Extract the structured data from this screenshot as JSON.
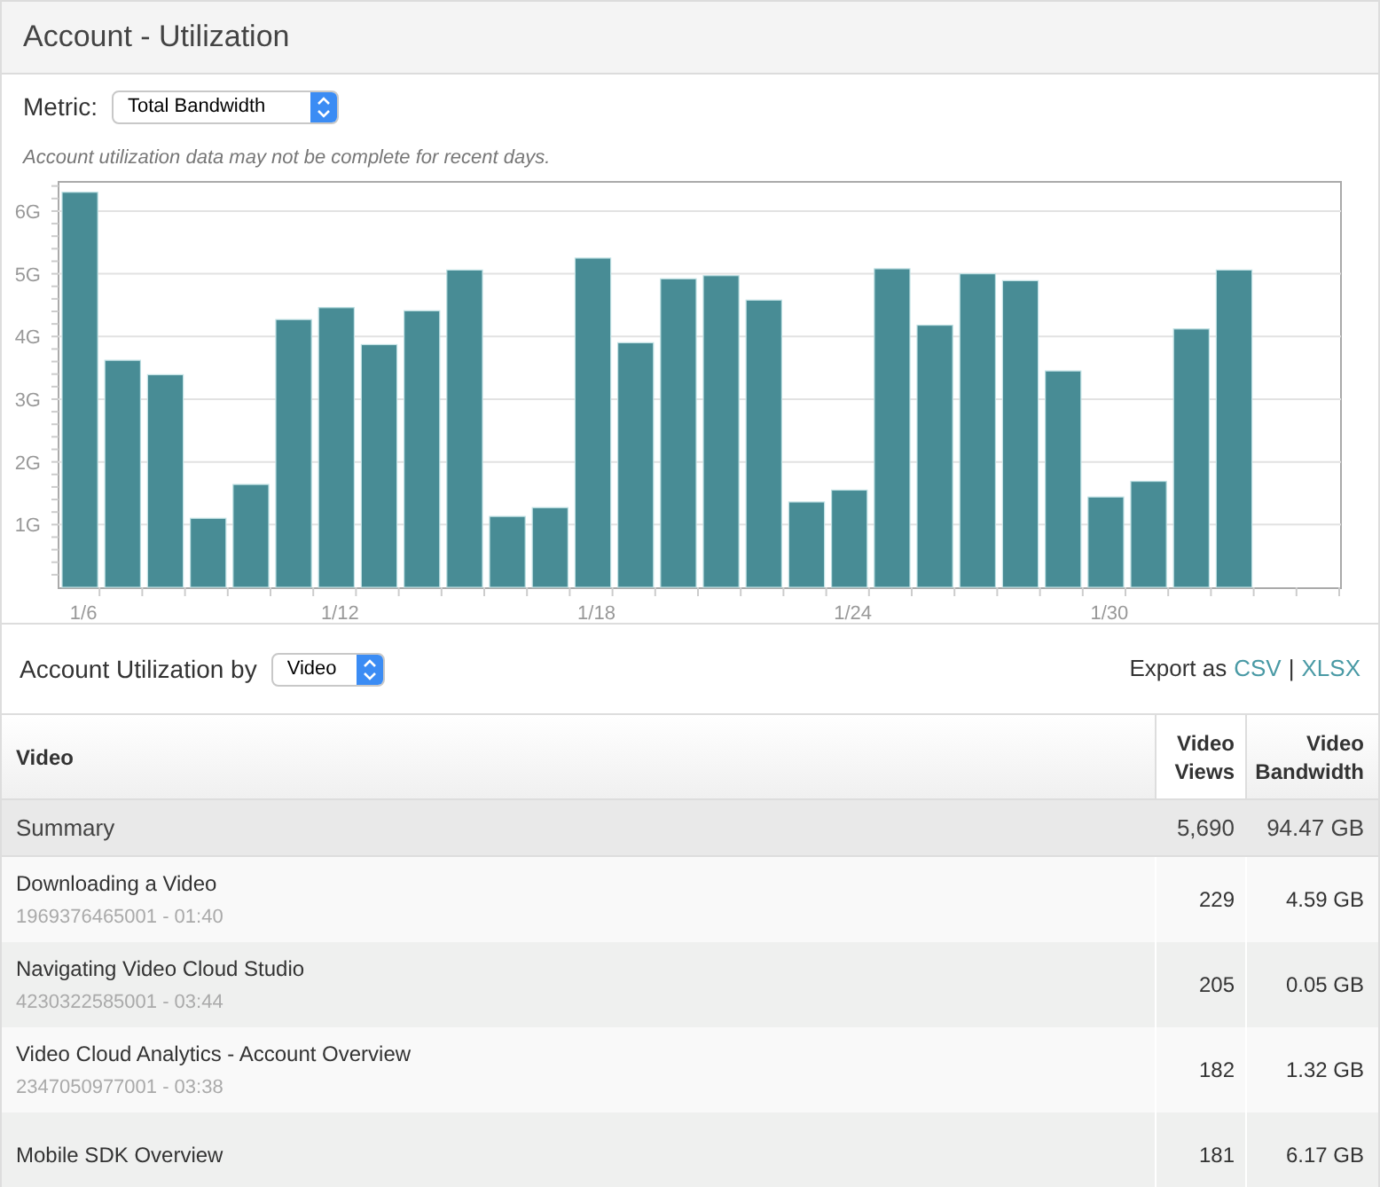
{
  "header": {
    "title": "Account - Utilization"
  },
  "metric": {
    "label": "Metric:",
    "value": "Total Bandwidth"
  },
  "note": "Account utilization data may not be complete for recent days.",
  "chart": {
    "chart_data": {
      "type": "bar",
      "ylim": [
        0,
        6.48
      ],
      "yticks": [
        {
          "value": 1,
          "label": "1G"
        },
        {
          "value": 2,
          "label": "2G"
        },
        {
          "value": 3,
          "label": "3G"
        },
        {
          "value": 4,
          "label": "4G"
        },
        {
          "value": 5,
          "label": "5G"
        },
        {
          "value": 6,
          "label": "6G"
        }
      ],
      "grid": true,
      "categories": [
        "1/6",
        null,
        null,
        null,
        null,
        null,
        "1/12",
        null,
        null,
        null,
        null,
        null,
        "1/18",
        null,
        null,
        null,
        null,
        null,
        "1/24",
        null,
        null,
        null,
        null,
        null,
        "1/30",
        null,
        null,
        null,
        null,
        null
      ],
      "series": [
        {
          "color": "#488c95",
          "values": [
            6.3,
            3.62,
            3.39,
            1.1,
            1.64,
            4.27,
            4.46,
            3.87,
            4.41,
            5.06,
            1.13,
            1.27,
            5.25,
            3.9,
            4.92,
            4.97,
            4.58,
            1.36,
            1.55,
            5.08,
            4.18,
            5.0,
            4.89,
            3.45,
            1.44,
            1.69,
            4.12,
            5.06,
            null,
            null
          ]
        }
      ]
    }
  },
  "breakdown": {
    "label": "Account Utilization by",
    "value": "Video",
    "export_label": "Export as",
    "links": [
      "CSV",
      "XLSX"
    ],
    "separator": "|"
  },
  "table": {
    "columns": [
      "Video",
      "Video Views",
      "Video Bandwidth"
    ],
    "summary": {
      "label": "Summary",
      "views": "5,690",
      "bandwidth": "94.47 GB"
    },
    "rows": [
      {
        "title": "Downloading a Video",
        "meta": "1969376465001 - 01:40",
        "views": "229",
        "bandwidth": "4.59 GB"
      },
      {
        "title": "Navigating Video Cloud Studio",
        "meta": "4230322585001 - 03:44",
        "views": "205",
        "bandwidth": "0.05 GB"
      },
      {
        "title": "Video Cloud Analytics - Account Overview",
        "meta": "2347050977001 - 03:38",
        "views": "182",
        "bandwidth": "1.32 GB"
      },
      {
        "title": "Mobile SDK Overview",
        "views": "181",
        "bandwidth": "6.17 GB"
      }
    ]
  }
}
